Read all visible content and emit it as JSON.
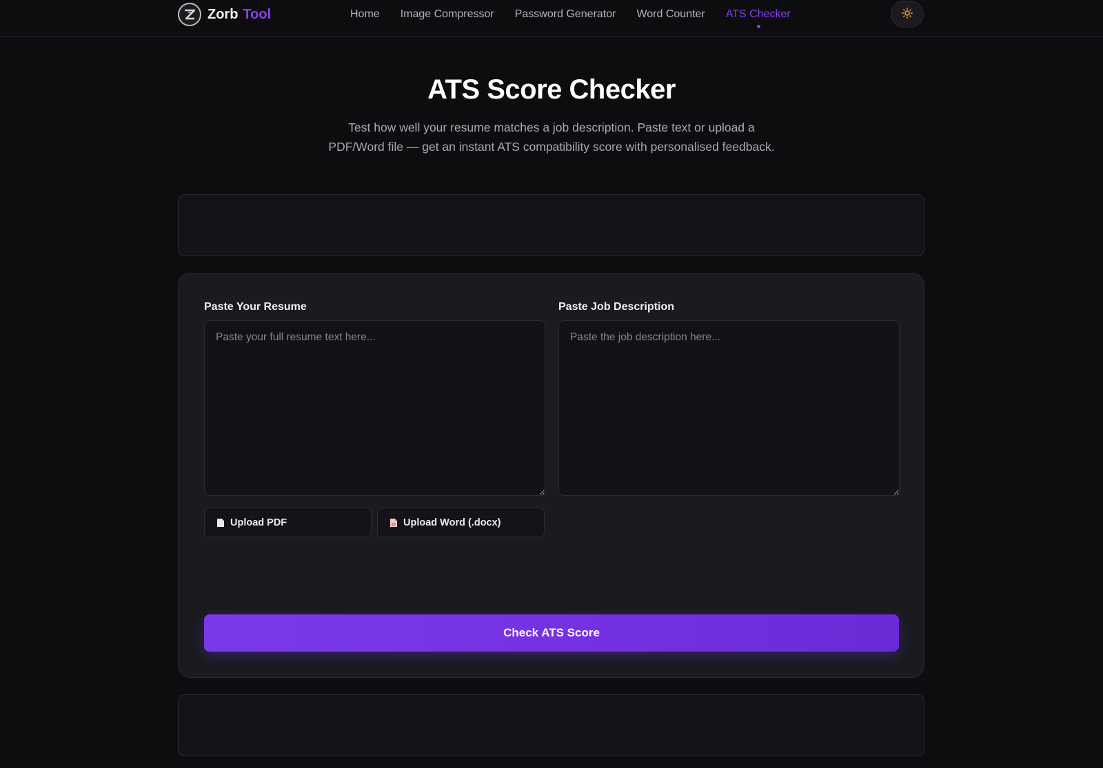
{
  "nav": {
    "brand_name": "Zorb",
    "brand_accent": "Tool",
    "links": [
      {
        "label": "Home"
      },
      {
        "label": "Image Compressor"
      },
      {
        "label": "Password Generator"
      },
      {
        "label": "Word Counter"
      },
      {
        "label": "ATS Checker"
      }
    ],
    "active_link": "ATS Checker",
    "theme_toggle_icon": "sun-icon"
  },
  "hero": {
    "title": "ATS Score Checker",
    "subtitle": "Test how well your resume matches a job description. Paste text or upload a PDF/Word file — get an instant ATS compatibility score with personalised feedback."
  },
  "form": {
    "resume_label": "Paste Your Resume",
    "resume_placeholder": "Paste your full resume text here...",
    "resume_value": "",
    "job_label": "Paste Job Description",
    "job_placeholder": "Paste the job description here...",
    "job_value": "",
    "upload_pdf_label": "Upload PDF",
    "upload_word_label": "Upload Word (.docx)",
    "submit_label": "Check ATS Score"
  },
  "colors": {
    "accent": "#8b3df6",
    "background": "#0d0d10",
    "card": "#1a1a1f",
    "theme_icon": "#f5a623"
  }
}
